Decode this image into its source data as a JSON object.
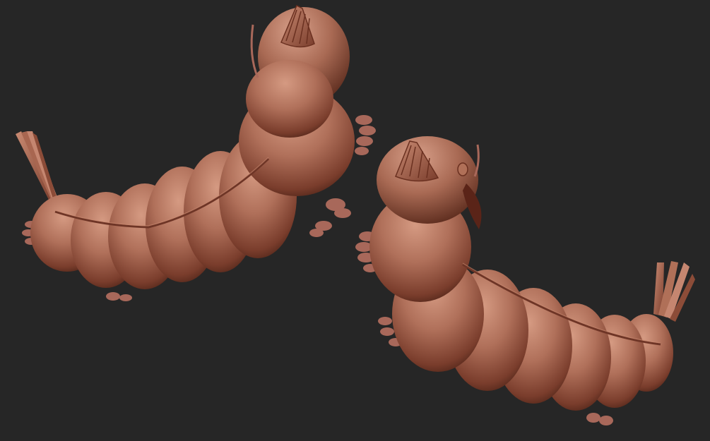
{
  "scene": {
    "background": "#262626",
    "clay_light": "#c98a72",
    "clay_mid": "#9c5a45",
    "clay_dark": "#5a2a1c",
    "subjects": [
      {
        "name": "larva-sculpt-left"
      },
      {
        "name": "larva-sculpt-right"
      }
    ]
  }
}
